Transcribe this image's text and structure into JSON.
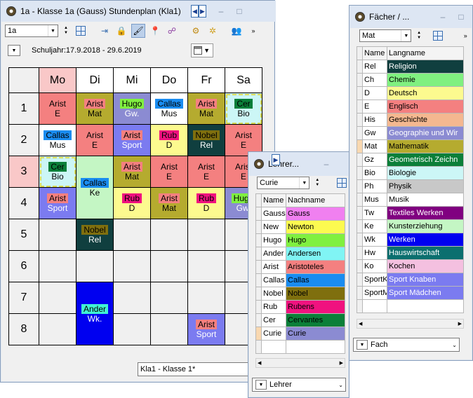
{
  "main": {
    "title": "1a - Klasse 1a (Gauss)  Stundenplan  (Kla1)",
    "class_value": "1a",
    "schuljahr": "Schuljahr:17.9.2018 - 29.6.2019",
    "days": [
      "Mo",
      "Di",
      "Mi",
      "Do",
      "Fr",
      "Sa"
    ],
    "periods": [
      "1",
      "2",
      "3",
      "4",
      "5",
      "6",
      "7",
      "8"
    ],
    "status": "Kla1 - Klasse 1*"
  },
  "colors": {
    "arist": "#f48080",
    "mat_bg": "#b5ab2f",
    "hugo": "#80f040",
    "gw_bg": "#8b8bd2",
    "callas": "#1a8cf0",
    "cer": "#0b7f39",
    "bio_bg": "#ccf6f6",
    "rub": "#f0127f",
    "d_bg": "#fcfa8f",
    "nobel": "#7f6f0e",
    "rel_bg": "#103f3f",
    "sport_bg": "#7b7bf0",
    "ke_bg": "#c4f6c4",
    "ander": "#40f4d4",
    "wk_bg": "#0000f0",
    "e_bg": "#f48080",
    "mus_bg": "#ffffff"
  },
  "lehrer": {
    "title": "Lehrer...",
    "value": "Curie",
    "headers": [
      "Name",
      "Nachname"
    ],
    "rows": [
      {
        "name": "Gauss",
        "nachname": "Gauss",
        "color": "#f080f0"
      },
      {
        "name": "New",
        "nachname": "Newton",
        "color": "#fcfa50"
      },
      {
        "name": "Hugo",
        "nachname": "Hugo",
        "color": "#80f040"
      },
      {
        "name": "Ander",
        "nachname": "Andersen",
        "color": "#80f4f4"
      },
      {
        "name": "Arist",
        "nachname": "Aristoteles",
        "color": "#f48080"
      },
      {
        "name": "Callas",
        "nachname": "Callas",
        "color": "#1a8cf0"
      },
      {
        "name": "Nobel",
        "nachname": "Nobel",
        "color": "#7f6f0e"
      },
      {
        "name": "Rub",
        "nachname": "Rubens",
        "color": "#f0127f"
      },
      {
        "name": "Cer",
        "nachname": "Cervantes",
        "color": "#0b7f39"
      },
      {
        "name": "Curie",
        "nachname": "Curie",
        "color": "#8b8bd2"
      }
    ],
    "bottom": "Lehrer"
  },
  "faecher": {
    "title": "Fächer / ...",
    "value": "Mat",
    "headers": [
      "Name",
      "Langname"
    ],
    "rows": [
      {
        "name": "Rel",
        "langname": "Religion",
        "color": "#103f3f",
        "fg": "#ffffff"
      },
      {
        "name": "Ch",
        "langname": "Chemie",
        "color": "#80f080",
        "fg": "#000000"
      },
      {
        "name": "D",
        "langname": "Deutsch",
        "color": "#fcfa8f",
        "fg": "#000000"
      },
      {
        "name": "E",
        "langname": "Englisch",
        "color": "#f48080",
        "fg": "#000000"
      },
      {
        "name": "His",
        "langname": "Geschichte",
        "color": "#f4b890",
        "fg": "#000000"
      },
      {
        "name": "Gw",
        "langname": "Geographie und Wir",
        "color": "#8b8bd2",
        "fg": "#ffffff"
      },
      {
        "name": "Mat",
        "langname": "Mathematik",
        "color": "#b5ab2f",
        "fg": "#000000"
      },
      {
        "name": "Gz",
        "langname": "Geometrisch Zeichn",
        "color": "#0b7f39",
        "fg": "#ffffff"
      },
      {
        "name": "Bio",
        "langname": "Biologie",
        "color": "#ccf6f6",
        "fg": "#000000"
      },
      {
        "name": "Ph",
        "langname": "Physik",
        "color": "#c8c8c8",
        "fg": "#000000"
      },
      {
        "name": "Mus",
        "langname": "Musik",
        "color": "#ffffff",
        "fg": "#000000"
      },
      {
        "name": "Tw",
        "langname": "Textiles Werken",
        "color": "#800080",
        "fg": "#ffffff"
      },
      {
        "name": "Ke",
        "langname": "Kunsterziehung",
        "color": "#c4f6c4",
        "fg": "#000000"
      },
      {
        "name": "Wk",
        "langname": "Werken",
        "color": "#0000f0",
        "fg": "#ffffff"
      },
      {
        "name": "Hw",
        "langname": "Hauswirtschaft",
        "color": "#0b6f6f",
        "fg": "#ffffff"
      },
      {
        "name": "Ko",
        "langname": "Kochen",
        "color": "#f4c0e0",
        "fg": "#000000"
      },
      {
        "name": "SportK",
        "langname": "Sport Knaben",
        "color": "#7b7bf0",
        "fg": "#ffffff"
      },
      {
        "name": "SportM",
        "langname": "Sport Mädchen",
        "color": "#7b7bf0",
        "fg": "#ffffff"
      }
    ],
    "bottom": "Fach"
  },
  "lessons": {
    "mo1": {
      "t": "Arist",
      "s": "E"
    },
    "di1": {
      "t": "Arist",
      "s": "Mat"
    },
    "mi1": {
      "t": "Hugo",
      "s": "Gw."
    },
    "do1": {
      "t": "Callas",
      "s": "Mus"
    },
    "fr1": {
      "t": "Arist",
      "s": "Mat"
    },
    "sa1": {
      "t": "Cer",
      "s": "Bio"
    },
    "mo2": {
      "t": "Callas",
      "s": "Mus"
    },
    "di2": {
      "t": "Arist",
      "s": "E"
    },
    "mi2": {
      "t": "Arist",
      "s": "Sport"
    },
    "do2": {
      "t": "Rub",
      "s": "D"
    },
    "fr2": {
      "t": "Nobel",
      "s": "Rel"
    },
    "sa2": {
      "t": "Arist",
      "s": "E"
    },
    "mo3": {
      "t": "Cer",
      "s": "Bio"
    },
    "di34": {
      "t": "Callas",
      "s": "Ke"
    },
    "mi3": {
      "t": "Arist",
      "s": "Mat"
    },
    "do3": {
      "t": "Arist",
      "s": "E"
    },
    "fr3": {
      "t": "Arist",
      "s": "E"
    },
    "sa3": {
      "t": "Arist",
      "s": "E"
    },
    "mo4": {
      "t": "Arist",
      "s": "Sport"
    },
    "mi4": {
      "t": "Rub",
      "s": "D"
    },
    "do4": {
      "t": "Arist",
      "s": "Mat"
    },
    "fr4": {
      "t": "Rub",
      "s": "D"
    },
    "sa4": {
      "t": "Hugo",
      "s": "Gw."
    },
    "di5": {
      "t": "Nobel",
      "s": "Rel"
    },
    "di78": {
      "t": "Ander",
      "s": "Wk."
    },
    "fr8": {
      "t": "Arist",
      "s": "Sport"
    }
  }
}
